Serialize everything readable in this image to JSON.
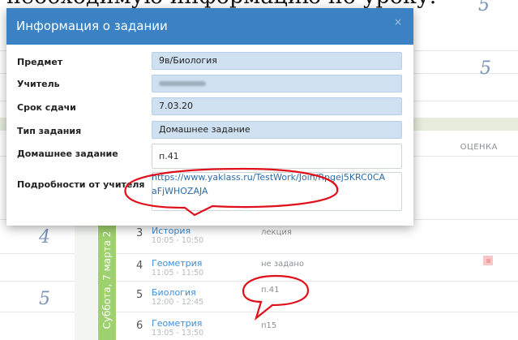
{
  "background": {
    "heading": "необходимую информацию по уроку.",
    "grade_top": "5",
    "grade_right": "5",
    "grade_left_a": "4",
    "grade_left_b": "5",
    "column_grade_header": "ОЦЕНКА",
    "day_label": "Суббота, 7 марта 2",
    "lessons": [
      {
        "num": "3",
        "name": "История",
        "time": "10:05 - 10:50",
        "homework": "лекция"
      },
      {
        "num": "4",
        "name": "Геометрия",
        "time": "11:05 - 11:50",
        "homework": "не задано"
      },
      {
        "num": "5",
        "name": "Биология",
        "time": "12:00 - 12:45",
        "homework": "п.41"
      },
      {
        "num": "6",
        "name": "Геометрия",
        "time": "13:05 - 13:50",
        "homework": "п15"
      }
    ]
  },
  "modal": {
    "title": "Информация о задании",
    "close_icon": "×",
    "fields": {
      "subject_label": "Предмет",
      "subject_value": "9в/Биология",
      "teacher_label": "Учитель",
      "due_label": "Срок сдачи",
      "due_value": "7.03.20",
      "type_label": "Тип задания",
      "type_value": "Домашнее задание",
      "homework_label": "Домашнее задание",
      "homework_value": "п.41",
      "details_label": "Подробности от учителя",
      "details_value": "https://www.yaklass.ru/TestWork/Join/Rpgej5KRC0CAaFjWHOZAJA"
    }
  },
  "colors": {
    "header_blue": "#3a82c4",
    "readonly_field": "#cfe0f0",
    "annotation_red": "#e0101a",
    "day_strip_green": "#9ed06f"
  }
}
